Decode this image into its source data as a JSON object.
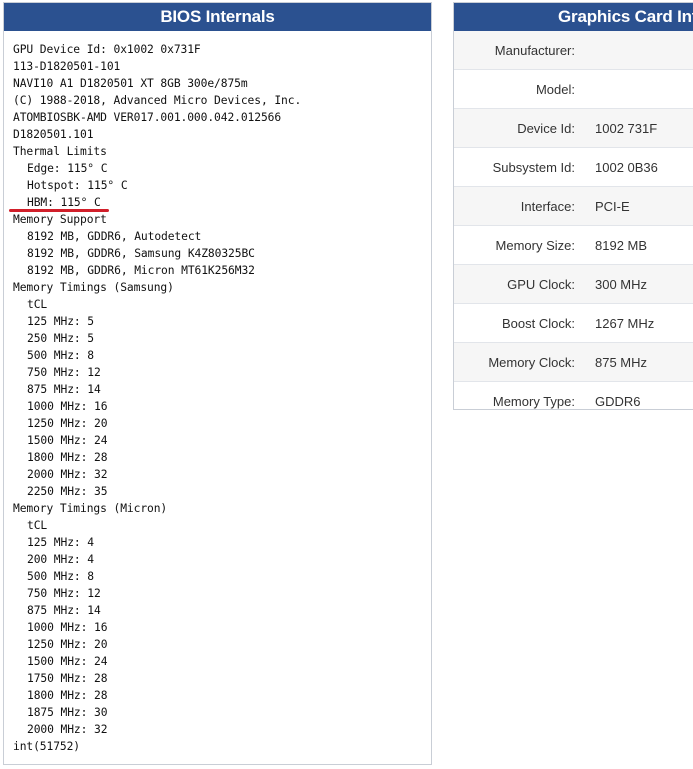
{
  "bios": {
    "title": "BIOS Internals",
    "lines": [
      {
        "text": "GPU Device Id: 0x1002 0x731F",
        "indent": false
      },
      {
        "text": "113-D1820501-101",
        "indent": false
      },
      {
        "text": "NAVI10 A1 D1820501 XT 8GB 300e/875m",
        "indent": false
      },
      {
        "text": "(C) 1988-2018, Advanced Micro Devices, Inc.",
        "indent": false
      },
      {
        "text": "ATOMBIOSBK-AMD VER017.001.000.042.012566",
        "indent": false
      },
      {
        "text": "D1820501.101",
        "indent": false
      },
      {
        "text": "Thermal Limits",
        "indent": false
      },
      {
        "text": "Edge: 115° C",
        "indent": true
      },
      {
        "text": "Hotspot: 115° C",
        "indent": true
      },
      {
        "text": "HBM: 115° C",
        "indent": true
      },
      {
        "text": "Memory Support",
        "indent": false
      },
      {
        "text": "8192 MB, GDDR6, Autodetect",
        "indent": true
      },
      {
        "text": "8192 MB, GDDR6, Samsung K4Z80325BC",
        "indent": true
      },
      {
        "text": "8192 MB, GDDR6, Micron MT61K256M32",
        "indent": true
      },
      {
        "text": "Memory Timings (Samsung)",
        "indent": false
      },
      {
        "text": "tCL",
        "indent": true
      },
      {
        "text": "125 MHz: 5",
        "indent": true
      },
      {
        "text": "250 MHz: 5",
        "indent": true
      },
      {
        "text": "500 MHz: 8",
        "indent": true
      },
      {
        "text": "750 MHz: 12",
        "indent": true
      },
      {
        "text": "875 MHz: 14",
        "indent": true
      },
      {
        "text": "1000 MHz: 16",
        "indent": true
      },
      {
        "text": "1250 MHz: 20",
        "indent": true
      },
      {
        "text": "1500 MHz: 24",
        "indent": true
      },
      {
        "text": "1800 MHz: 28",
        "indent": true
      },
      {
        "text": "2000 MHz: 32",
        "indent": true
      },
      {
        "text": "2250 MHz: 35",
        "indent": true
      },
      {
        "text": "Memory Timings (Micron)",
        "indent": false
      },
      {
        "text": "tCL",
        "indent": true
      },
      {
        "text": "125 MHz: 4",
        "indent": true
      },
      {
        "text": "200 MHz: 4",
        "indent": true
      },
      {
        "text": "500 MHz: 8",
        "indent": true
      },
      {
        "text": "750 MHz: 12",
        "indent": true
      },
      {
        "text": "875 MHz: 14",
        "indent": true
      },
      {
        "text": "1000 MHz: 16",
        "indent": true
      },
      {
        "text": "1250 MHz: 20",
        "indent": true
      },
      {
        "text": "1500 MHz: 24",
        "indent": true
      },
      {
        "text": "1750 MHz: 28",
        "indent": true
      },
      {
        "text": "1800 MHz: 28",
        "indent": true
      },
      {
        "text": "1875 MHz: 30",
        "indent": true
      },
      {
        "text": "2000 MHz: 32",
        "indent": true
      },
      {
        "text": "int(51752)",
        "indent": false
      }
    ],
    "highlight_color": "#d11f2a"
  },
  "card": {
    "title": "Graphics Card Info",
    "rows": [
      {
        "label": "Manufacturer:",
        "value": ""
      },
      {
        "label": "Model:",
        "value": ""
      },
      {
        "label": "Device Id:",
        "value": "1002 731F"
      },
      {
        "label": "Subsystem Id:",
        "value": "1002 0B36"
      },
      {
        "label": "Interface:",
        "value": "PCI-E"
      },
      {
        "label": "Memory Size:",
        "value": "8192 MB"
      },
      {
        "label": "GPU Clock:",
        "value": "300 MHz"
      },
      {
        "label": "Boost Clock:",
        "value": "1267 MHz"
      },
      {
        "label": "Memory Clock:",
        "value": "875 MHz"
      },
      {
        "label": "Memory Type:",
        "value": "GDDR6"
      }
    ]
  },
  "colors": {
    "header_bg": "#2b5190",
    "header_text": "#ffffff",
    "border": "#c9ced6"
  }
}
